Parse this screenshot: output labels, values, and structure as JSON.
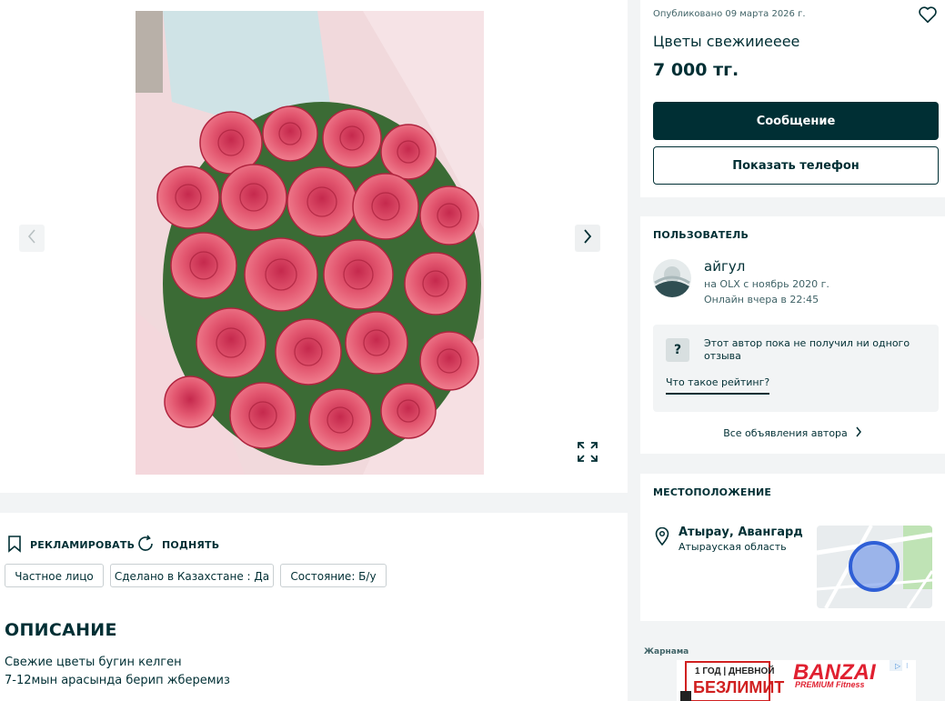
{
  "gallery": {
    "prev_icon": "chevron-left-icon",
    "next_icon": "chevron-right-icon",
    "expand_icon": "expand-icon"
  },
  "actions": {
    "promote": "РЕКЛАМИРОВАТЬ",
    "raise": "ПОДНЯТЬ"
  },
  "tags": [
    "Частное лицо",
    "Сделано в Казахстане : Да",
    "Состояние: Б/у"
  ],
  "description": {
    "title": "ОПИСАНИЕ",
    "lines": [
      "Свежие цветы бугин келген",
      "7-12мын арасында берип жберемиз"
    ]
  },
  "listing": {
    "published": "Опубликовано 09 марта 2026 г.",
    "title": "Цветы свежииееее",
    "price": "7 000 тг.",
    "message_button": "Сообщение",
    "phone_button": "Показать телефон"
  },
  "user": {
    "section_title": "ПОЛЬЗОВАТЕЛЬ",
    "name": "айгул",
    "since": "на OLX с ноябрь 2020 г.",
    "online": "Онлайн вчера в 22:45",
    "rating_text": "Этот автор пока не получил ни одного отзыва",
    "rating_link": "Что такое рейтинг?",
    "all_ads": "Все объявления автора"
  },
  "location": {
    "section_title": "МЕСТОПОЛОЖЕНИЕ",
    "city": "Атырау, Авангард",
    "region": "Атырауская область"
  },
  "ad": {
    "label": "Жарнама",
    "line1": "1 ГОД | ДНЕВНОЙ",
    "line2": "БЕЗЛИМИТ",
    "brand": "BANZAI",
    "sub": "PREMIUM Fitness"
  },
  "colors": {
    "primary": "#002f34",
    "background": "#f2f4f5",
    "rose": "#e0506e"
  }
}
